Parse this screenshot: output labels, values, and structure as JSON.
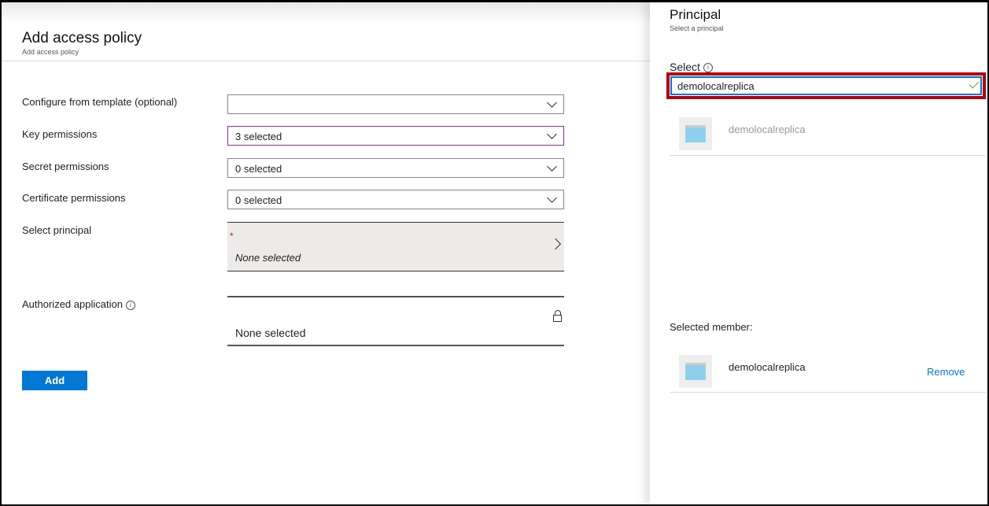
{
  "left": {
    "title": "Add access policy",
    "subtitle": "Add access policy",
    "fields": [
      {
        "label": "Configure from template (optional)",
        "value": ""
      },
      {
        "label": "Key permissions",
        "value": "3 selected"
      },
      {
        "label": "Secret permissions",
        "value": "0 selected"
      },
      {
        "label": "Certificate permissions",
        "value": "0 selected"
      }
    ],
    "principal": {
      "label": "Select principal",
      "required": "*",
      "value": "None selected"
    },
    "authorized": {
      "label": "Authorized application",
      "info": "i",
      "value": "None selected"
    },
    "add_label": "Add"
  },
  "right": {
    "title": "Principal",
    "subtitle": "Select a principal",
    "select_label": "Select",
    "info": "i",
    "search_value": "demolocalreplica",
    "result": "demolocalreplica",
    "selected_label": "Selected member:",
    "selected_member": "demolocalreplica",
    "remove_label": "Remove"
  },
  "colors": {
    "accent": "#0078d4",
    "highlight": "#b0000e",
    "focus_border": "#8a2ea8"
  }
}
